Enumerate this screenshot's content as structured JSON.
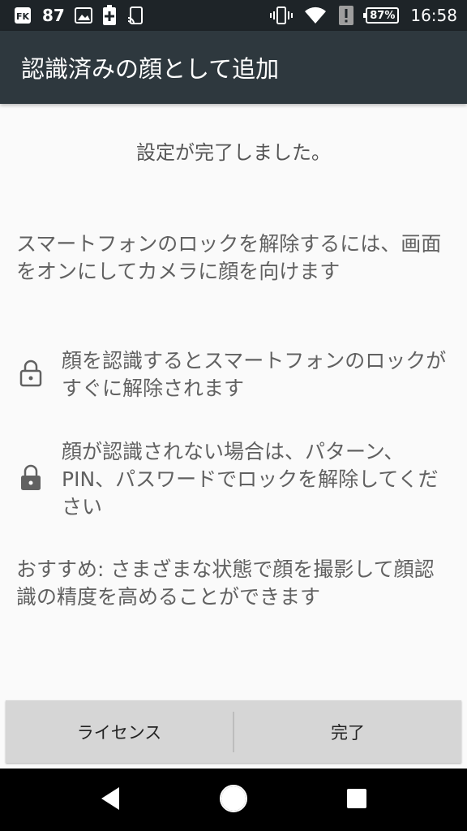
{
  "status_bar": {
    "notification_count": "87",
    "battery_percent": "87%",
    "time": "16:58"
  },
  "app_bar": {
    "title": "認識済みの顔として追加"
  },
  "content": {
    "done_message": "設定が完了しました。",
    "instruction": "スマートフォンのロックを解除するには、画面をオンにしてカメラに顔を向けます",
    "bullets": [
      {
        "icon": "lock-open-icon",
        "text": "顔を認識するとスマートフォンのロックがすぐに解除されます"
      },
      {
        "icon": "lock-icon",
        "text": "顔が認識されない場合は、パターン、PIN、パスワードでロックを解除してください"
      }
    ],
    "tip": "おすすめ: さまざまな状態で顔を撮影して顔認識の精度を高めることができます"
  },
  "buttons": {
    "license_label": "ライセンス",
    "done_label": "完了"
  },
  "colors": {
    "status_bar_bg": "#1e2428",
    "app_bar_bg": "#2e383e",
    "page_bg": "#fafafa",
    "button_bar_bg": "#d6d6d6"
  }
}
